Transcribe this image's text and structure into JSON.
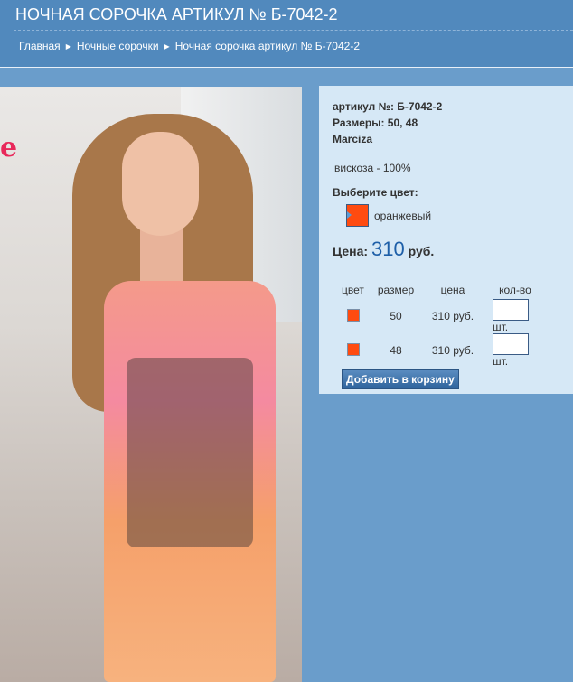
{
  "header": {
    "title": "НОЧНАЯ СОРОЧКА АРТИКУЛ № Б-7042-2",
    "breadcrumbs": [
      {
        "label": "Главная"
      },
      {
        "label": "Ночные сорочки"
      },
      {
        "label": "Ночная сорочка артикул № Б-7042-2"
      }
    ]
  },
  "product": {
    "article": "артикул №: Б-7042-2",
    "sizes": "Размеры: 50, 48",
    "brand": "Marciza",
    "material": "вискоза - 100%",
    "choose_color": "Выберите цвет:",
    "color_name": "оранжевый",
    "color_hex": "#ff4b10",
    "price_label": "Цена:",
    "price_value": "310",
    "price_currency": "руб."
  },
  "variants": {
    "headers": [
      "цвет",
      "размер",
      "цена",
      "кол-во"
    ],
    "rows": [
      {
        "size": "50",
        "price": "310 руб.",
        "qty": "",
        "unit": "шт."
      },
      {
        "size": "48",
        "price": "310 руб.",
        "qty": "",
        "unit": "шт."
      }
    ]
  },
  "add_to_cart": "Добавить в корзину",
  "photo": {
    "logo_text": "e"
  }
}
